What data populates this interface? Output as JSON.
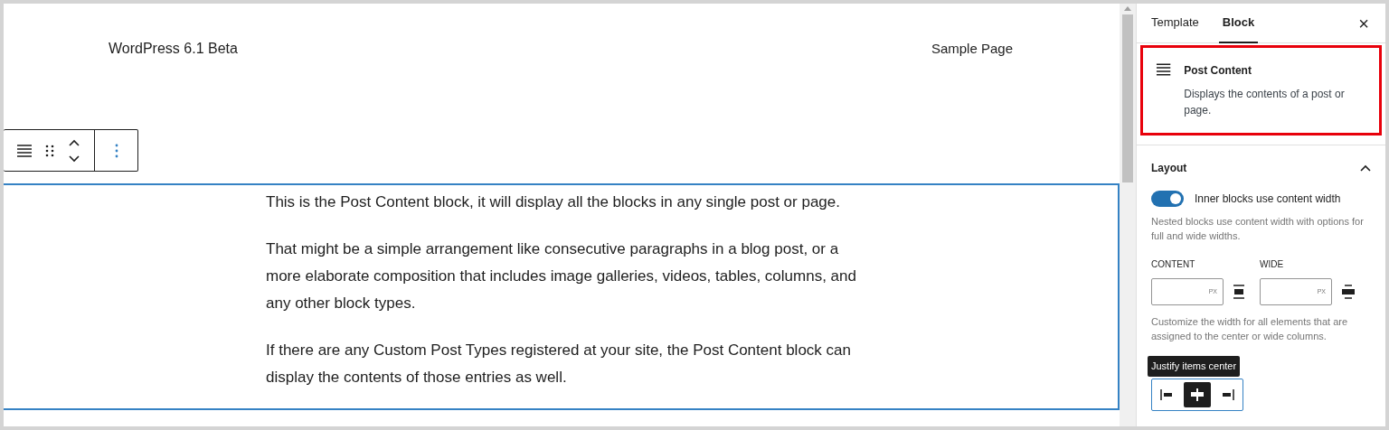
{
  "site_title": "WordPress 6.1 Beta",
  "nav_link": "Sample Page",
  "paragraphs": [
    "This is the Post Content block, it will display all the blocks in any single post or page.",
    "That might be a simple arrangement like consecutive paragraphs in a blog post, or a more elaborate composition that includes image galleries, videos, tables, columns, and any other block types.",
    "If there are any Custom Post Types registered at your site, the Post Content block can display the contents of those entries as well."
  ],
  "sidebar": {
    "tabs": [
      {
        "label": "Template",
        "selected": false
      },
      {
        "label": "Block",
        "selected": true
      }
    ],
    "close": "×",
    "block_card": {
      "title": "Post Content",
      "description": "Displays the contents of a post or page.",
      "highlighted": true
    },
    "layout": {
      "title": "Layout",
      "expanded": true,
      "toggle": {
        "label": "Inner blocks use content width",
        "on": true
      },
      "help": "Nested blocks use content width with options for full and wide widths.",
      "fields": [
        {
          "label": "CONTENT",
          "unit": "PX",
          "kind": "content"
        },
        {
          "label": "WIDE",
          "unit": "PX",
          "kind": "wide"
        }
      ],
      "width_help": "Customize the width for all elements that are assigned to the center or wide columns.",
      "tooltip": "Justify items center",
      "justify": [
        {
          "kind": "left",
          "selected": false
        },
        {
          "kind": "center",
          "selected": true
        },
        {
          "kind": "right",
          "selected": false
        }
      ]
    }
  }
}
